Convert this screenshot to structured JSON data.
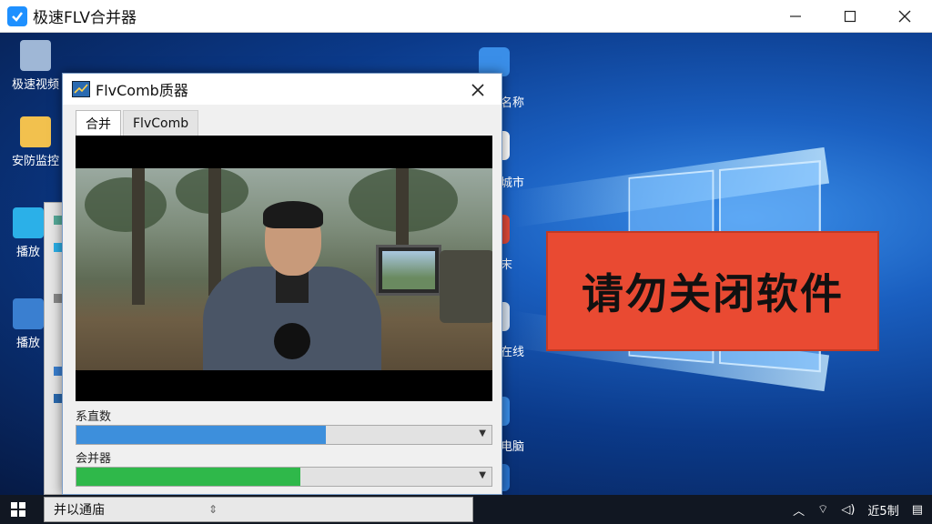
{
  "window": {
    "title": "极速FLV合并器",
    "controls": {
      "minimize": "—",
      "maximize": "☐",
      "close": "✕"
    }
  },
  "desktop": {
    "left_icons": [
      {
        "label": "极速视频",
        "icon": "control-panel-icon",
        "color": "#9fb7d6"
      },
      {
        "label": "安防监控",
        "icon": "folder-icon",
        "color": "#f2c14e"
      },
      {
        "label": "播放",
        "icon": "app-icon",
        "color": "#2bb0e8"
      },
      {
        "label": "播放",
        "icon": "app-icon",
        "color": "#3a7fd0"
      }
    ],
    "right_icons": [
      {
        "label": "名称",
        "icon": "shield-icon",
        "color": "#3a8ee8"
      },
      {
        "label": "城市",
        "icon": "globe-icon",
        "color": "#ffffff"
      },
      {
        "label": "末",
        "icon": "app-icon",
        "color": "#e04a3a"
      },
      {
        "label": "在线",
        "icon": "doc-icon",
        "color": "#d8e4f2"
      },
      {
        "label": "电脑",
        "icon": "computer-icon",
        "color": "#3a8ee8"
      },
      {
        "label": "",
        "icon": "shield-icon",
        "color": "#2a76d2"
      }
    ],
    "warning_text": "请勿关闭软件"
  },
  "dialog": {
    "title": "FlvComb质器",
    "tabs": [
      {
        "label": "合并",
        "active": true
      },
      {
        "label": "FlvComb",
        "active": false
      }
    ],
    "progress_1": {
      "label": "系直数",
      "fraction": 0.6,
      "color": "#3d8fdc"
    },
    "progress_2": {
      "label": "会并器",
      "fraction": 0.54,
      "color": "#2fb84a"
    }
  },
  "taskbar": {
    "task_label": "并以通庙",
    "tray": {
      "time": "近5制",
      "icons": [
        "up-chevron-icon",
        "network-icon",
        "volume-icon",
        "notification-icon"
      ]
    }
  }
}
